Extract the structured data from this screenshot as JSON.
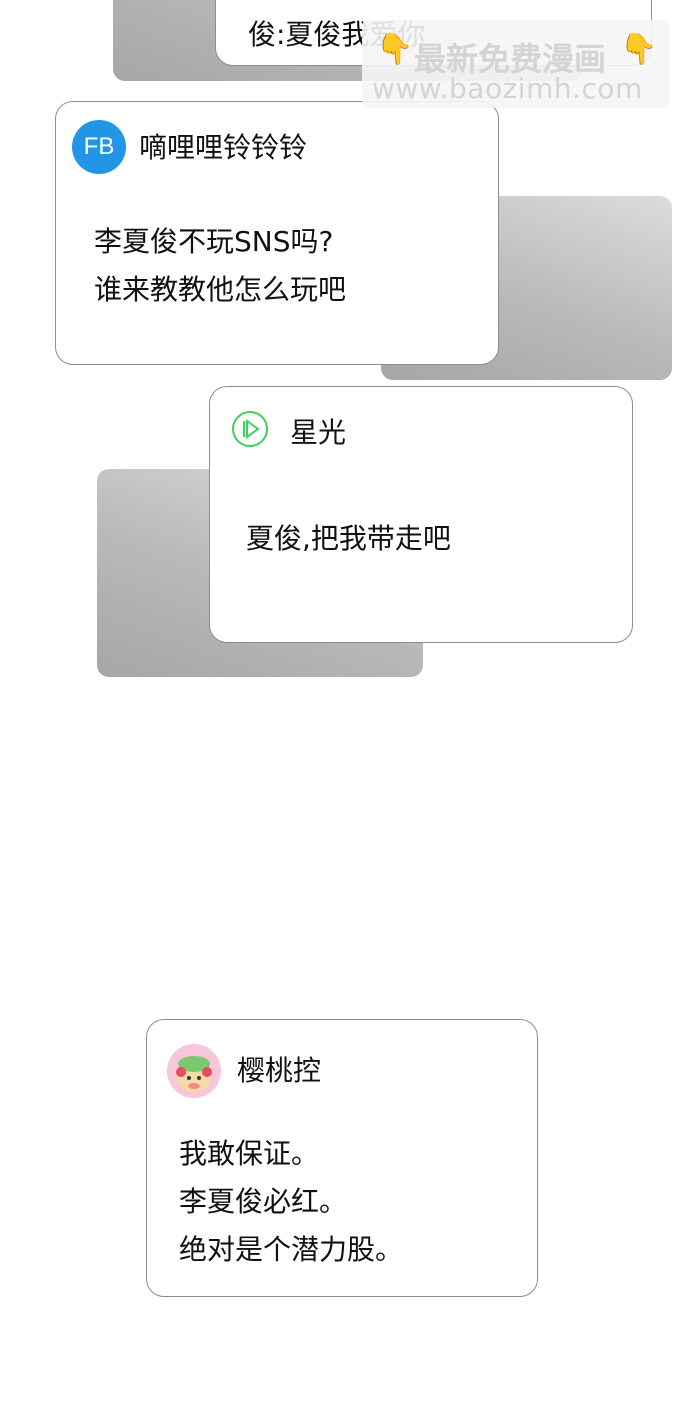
{
  "posts": [
    {
      "username": "",
      "message": "俊:夏俊我爱你"
    },
    {
      "username": "嘀哩哩铃铃铃",
      "avatar_text": "FB",
      "avatar_icon": "fb-icon",
      "avatar_color": "#2196e6",
      "message": "李夏俊不玩SNS吗?\n谁来教教他怎么玩吧"
    },
    {
      "username": "星光",
      "avatar_icon": "play-icon",
      "avatar_color": "#3ecf5f",
      "message": "夏俊,把我带走吧"
    },
    {
      "username": "樱桃控",
      "avatar_icon": "cherry-character-avatar",
      "avatar_color": "#f7c6da",
      "message": "我敢保证。\n李夏俊必红。\n绝对是个潜力股。"
    }
  ],
  "watermark": {
    "line1": "最新免费漫画",
    "line2": "www.baozimh.com",
    "icon": "pointing-down-hand-icon"
  }
}
